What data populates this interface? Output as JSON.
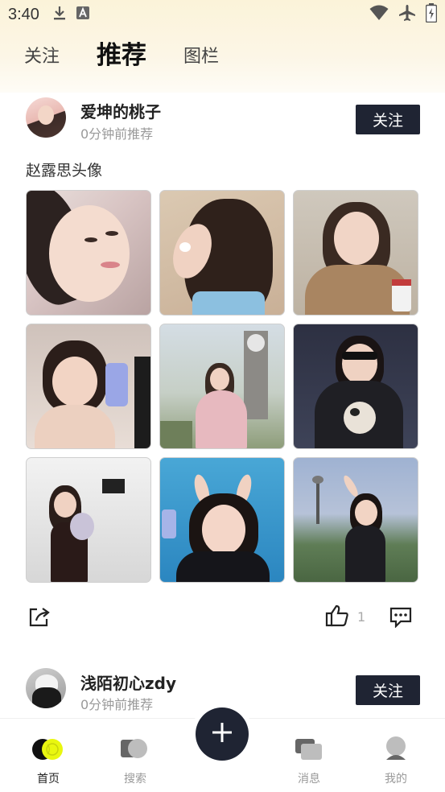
{
  "status_bar": {
    "time": "3:40",
    "left_icons": [
      "download-icon",
      "a-icon"
    ],
    "right_icons": [
      "wifi-icon",
      "airplane-icon",
      "battery-icon"
    ]
  },
  "tabs": [
    {
      "label": "关注",
      "active": false
    },
    {
      "label": "推荐",
      "active": true
    },
    {
      "label": "图栏",
      "active": false
    }
  ],
  "posts": [
    {
      "author": "爱坤的桃子",
      "time": "0分钟前推荐",
      "follow_label": "关注",
      "caption": "赵露思头像",
      "like_count": "1",
      "images": [
        {
          "desc": "photo-1"
        },
        {
          "desc": "photo-2"
        },
        {
          "desc": "photo-3"
        },
        {
          "desc": "photo-4"
        },
        {
          "desc": "photo-5"
        },
        {
          "desc": "photo-6"
        },
        {
          "desc": "photo-7"
        },
        {
          "desc": "photo-8"
        },
        {
          "desc": "photo-9"
        }
      ]
    },
    {
      "author": "浅陌初心zdy",
      "time": "0分钟前推荐",
      "follow_label": "关注"
    }
  ],
  "bottom_nav": [
    {
      "label": "首页",
      "icon": "home-icon",
      "active": true
    },
    {
      "label": "搜索",
      "icon": "search-icon",
      "active": false
    },
    {
      "label": "",
      "icon": "plus-icon",
      "active": false
    },
    {
      "label": "消息",
      "icon": "message-icon",
      "active": false
    },
    {
      "label": "我的",
      "icon": "profile-icon",
      "active": false
    }
  ],
  "colors": {
    "accent": "#e9f70f",
    "dark_button": "#1f2433",
    "muted_text": "#9a9a9a"
  }
}
